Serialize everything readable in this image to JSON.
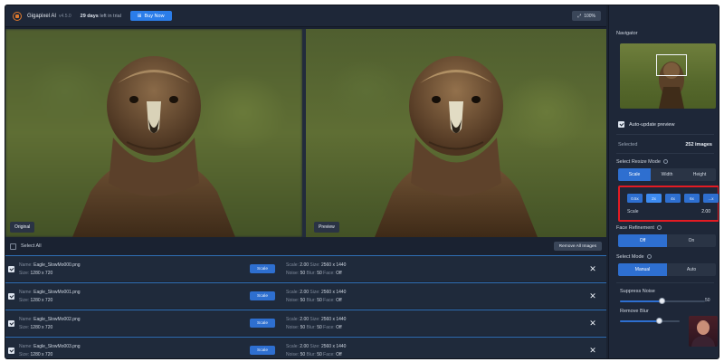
{
  "app": {
    "name": "Gigapixel AI",
    "version": "v4.5.0",
    "trial_days": "29 days",
    "trial_suffix": "left in trial",
    "buy_label": "Buy Now",
    "zoom_label": "100%"
  },
  "panels": {
    "left_label": "Original",
    "right_label": "Preview"
  },
  "list": {
    "select_all": "Select All",
    "remove_all": "Remove All Images",
    "rows": [
      {
        "name": "Eagle_SlowMo000.png",
        "in_size": "1280 x 720",
        "scale_label": "Scale",
        "scale": "2.00",
        "out_size": "2560 x 1440",
        "noise": "50",
        "blur": "50",
        "face": "Off"
      },
      {
        "name": "Eagle_SlowMo001.png",
        "in_size": "1280 x 720",
        "scale_label": "Scale",
        "scale": "2.00",
        "out_size": "2560 x 1440",
        "noise": "50",
        "blur": "50",
        "face": "Off"
      },
      {
        "name": "Eagle_SlowMo002.png",
        "in_size": "1280 x 720",
        "scale_label": "Scale",
        "scale": "2.00",
        "out_size": "2560 x 1440",
        "noise": "50",
        "blur": "50",
        "face": "Off"
      },
      {
        "name": "Eagle_SlowMo003.png",
        "in_size": "1280 x 720",
        "scale_label": "Scale",
        "scale": "2.00",
        "out_size": "2560 x 1440",
        "noise": "50",
        "blur": "50",
        "face": "Off"
      }
    ],
    "labels": {
      "name": "Name:",
      "size": "Size:",
      "scale": "Scale:",
      "noise": "Noise:",
      "blur": "Blur:",
      "face": "Face:"
    }
  },
  "sidebar": {
    "navigator": "Navigator",
    "auto_update": "Auto-update preview",
    "selected_label": "Selected",
    "selected_value": "252 images",
    "resize_mode_title": "Select Resize Mode",
    "resize_modes": [
      "Scale",
      "Width",
      "Height"
    ],
    "scale_buttons": [
      "0.5x",
      "2x",
      "4x",
      "6x",
      "...x"
    ],
    "scale_label": "Scale",
    "scale_value": "2.00",
    "face_title": "Face Refinement",
    "face_options": [
      "Off",
      "On"
    ],
    "mode_title": "Select Mode",
    "mode_options": [
      "Manual",
      "Auto"
    ],
    "suppress_noise": "Suppress Noise",
    "suppress_noise_value": "50",
    "remove_blur": "Remove Blur",
    "colors": {
      "accent": "#2e6fd0",
      "highlight": "#e31b23",
      "logo": "#e0792c"
    }
  }
}
